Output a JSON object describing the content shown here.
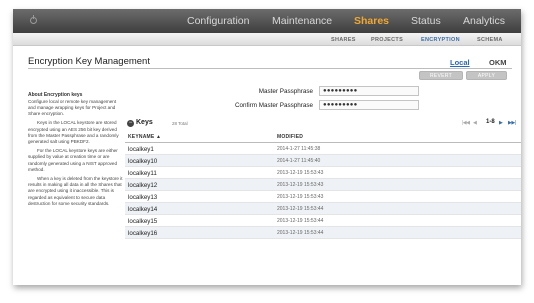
{
  "topnav": {
    "items": [
      {
        "label": "Configuration"
      },
      {
        "label": "Maintenance"
      },
      {
        "label": "Shares"
      },
      {
        "label": "Status"
      },
      {
        "label": "Analytics"
      }
    ],
    "active": "Shares"
  },
  "subnav": {
    "items": [
      {
        "label": "SHARES"
      },
      {
        "label": "PROJECTS"
      },
      {
        "label": "ENCRYPTION"
      },
      {
        "label": "SCHEMA"
      }
    ],
    "active": "ENCRYPTION"
  },
  "page": {
    "title": "Encryption Key Management",
    "links": {
      "local": "Local",
      "okm": "OKM"
    },
    "buttons": {
      "revert": "REVERT",
      "apply": "APPLY"
    }
  },
  "sidebar": {
    "heading": "About Encryption keys",
    "paragraphs": [
      "Configure local or remote key management and manage wrapping keys for Project and Share encryption.",
      "Keys in the LOCAL keystore are stored encrypted using an AES 256 bit key derived from the Master Passphrase and a randomly generated salt using PBKDF2.",
      "For the LOCAL keystore keys are either supplied by value at creation time or are randomly generated using a NIST approved method.",
      "When a key is deleted from the keystore it results in making all data in all the Shares that are encrypted using it inaccessible. This is regarded as equivalent to secure data destruction for some security standards."
    ]
  },
  "passphrase": {
    "master_label": "Master Passphrase",
    "master_value": "●●●●●●●●●",
    "confirm_label": "Confirm Master Passphrase",
    "confirm_value": "●●●●●●●●●"
  },
  "keys": {
    "title": "Keys",
    "count": "28 Total",
    "pager": {
      "first": "|◀◀",
      "prev": "◀",
      "range": "1-8",
      "next": "▶",
      "last": "▶▶|"
    },
    "columns": {
      "keyname": "KEYNAME ▲",
      "modified": "MODIFIED"
    },
    "rows": [
      {
        "name": "localkey1",
        "modified": "2014-1-27 11:45:38"
      },
      {
        "name": "localkey10",
        "modified": "2014-1-27 11:45:40"
      },
      {
        "name": "localkey11",
        "modified": "2013-12-19 15:53:43"
      },
      {
        "name": "localkey12",
        "modified": "2013-12-19 15:53:43"
      },
      {
        "name": "localkey13",
        "modified": "2013-12-19 15:53:43"
      },
      {
        "name": "localkey14",
        "modified": "2013-12-19 15:53:44"
      },
      {
        "name": "localkey15",
        "modified": "2013-12-19 15:53:44"
      },
      {
        "name": "localkey16",
        "modified": "2013-12-19 15:53:44"
      }
    ]
  },
  "colors": {
    "topbar": "#4a4a4a",
    "active_nav": "#f0a830",
    "link": "#2a68b8",
    "row_alt": "#eef1f5"
  },
  "icons": {
    "power": "power-icon",
    "collapse": "collapse-icon",
    "sort": "sort-ascending-icon"
  }
}
